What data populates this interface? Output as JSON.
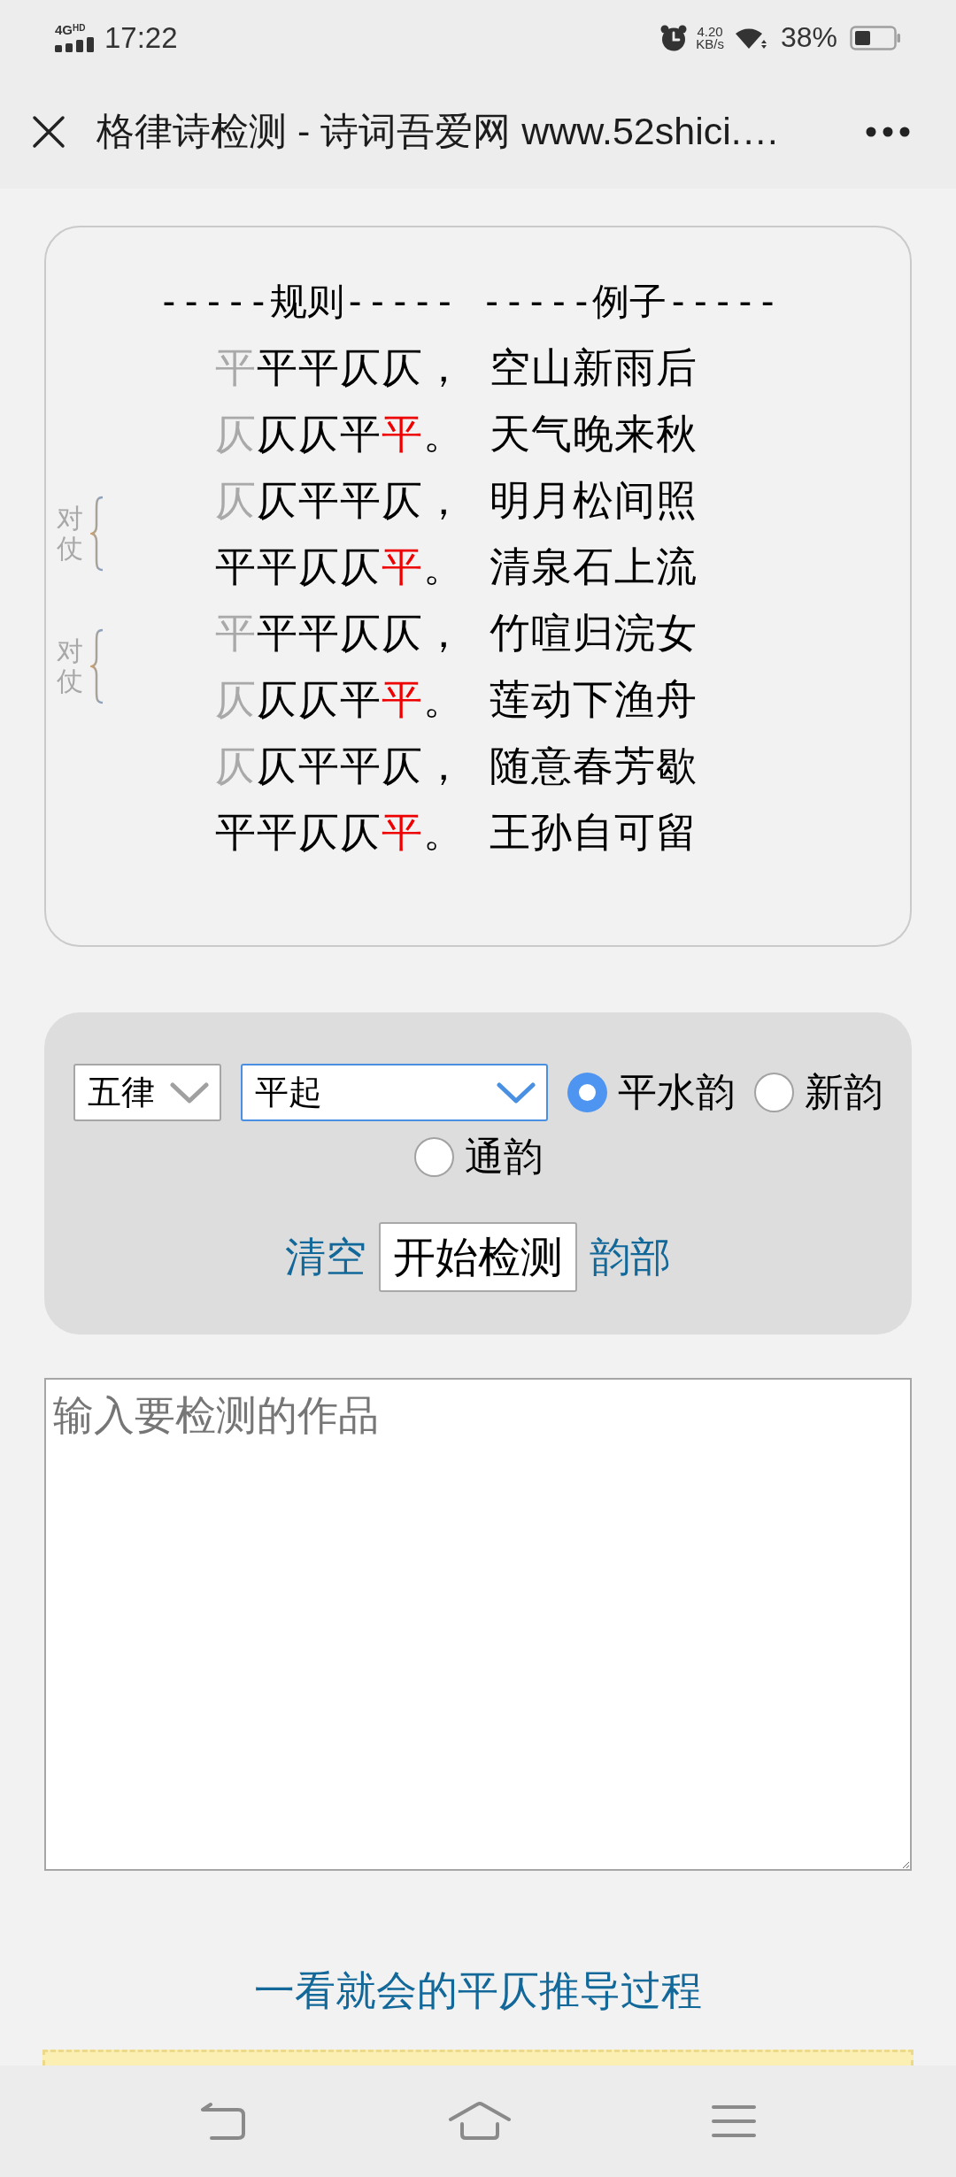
{
  "status_bar": {
    "network_type": "4G",
    "network_badge": "HD",
    "time": "17:22",
    "speed_value": "4.20",
    "speed_unit": "KB/s",
    "battery_percent": "38%"
  },
  "title_bar": {
    "title": "格律诗检测 - 诗词吾爱网 www.52shici.…"
  },
  "rules_box": {
    "rule_heading": "-----规则-----",
    "example_heading": "-----例子-----",
    "couplets": [
      {
        "lines": [
          {
            "rule": [
              {
                "text": "平",
                "kind": "flexible"
              },
              {
                "text": "平平仄仄，",
                "kind": "fixed"
              }
            ],
            "example": "空山新雨后"
          },
          {
            "rule": [
              {
                "text": "仄",
                "kind": "flexible"
              },
              {
                "text": "仄仄平",
                "kind": "fixed"
              },
              {
                "text": "平",
                "kind": "rhyme"
              },
              {
                "text": "。",
                "kind": "fixed"
              }
            ],
            "example": "天气晚来秋"
          }
        ]
      },
      {
        "marker": "对仗",
        "lines": [
          {
            "rule": [
              {
                "text": "仄",
                "kind": "flexible"
              },
              {
                "text": "仄平平仄，",
                "kind": "fixed"
              }
            ],
            "example": "明月松间照"
          },
          {
            "rule": [
              {
                "text": "平平仄仄",
                "kind": "fixed"
              },
              {
                "text": "平",
                "kind": "rhyme"
              },
              {
                "text": "。",
                "kind": "fixed"
              }
            ],
            "example": "清泉石上流"
          }
        ]
      },
      {
        "marker": "对仗",
        "lines": [
          {
            "rule": [
              {
                "text": "平",
                "kind": "flexible"
              },
              {
                "text": "平平仄仄，",
                "kind": "fixed"
              }
            ],
            "example": "竹喧归浣女"
          },
          {
            "rule": [
              {
                "text": "仄",
                "kind": "flexible"
              },
              {
                "text": "仄仄平",
                "kind": "fixed"
              },
              {
                "text": "平",
                "kind": "rhyme"
              },
              {
                "text": "。",
                "kind": "fixed"
              }
            ],
            "example": "莲动下渔舟"
          }
        ]
      },
      {
        "lines": [
          {
            "rule": [
              {
                "text": "仄",
                "kind": "flexible"
              },
              {
                "text": "仄平平仄，",
                "kind": "fixed"
              }
            ],
            "example": "随意春芳歇"
          },
          {
            "rule": [
              {
                "text": "平平仄仄",
                "kind": "fixed"
              },
              {
                "text": "平",
                "kind": "rhyme"
              },
              {
                "text": "。",
                "kind": "fixed"
              }
            ],
            "example": "王孙自可留"
          }
        ]
      }
    ]
  },
  "controls": {
    "form_select": {
      "value": "五律",
      "focused": false
    },
    "start_select": {
      "value": "平起",
      "focused": true
    },
    "rhyme_options": [
      {
        "label": "平水韵",
        "selected": true
      },
      {
        "label": "新韵",
        "selected": false
      },
      {
        "label": "通韵",
        "selected": false
      }
    ],
    "clear_link": "清空",
    "check_button": "开始检测",
    "rhyme_link": "韵部"
  },
  "poem_input": {
    "placeholder": "输入要检测的作品"
  },
  "guide_link": "一看就会的平仄推导过程"
}
